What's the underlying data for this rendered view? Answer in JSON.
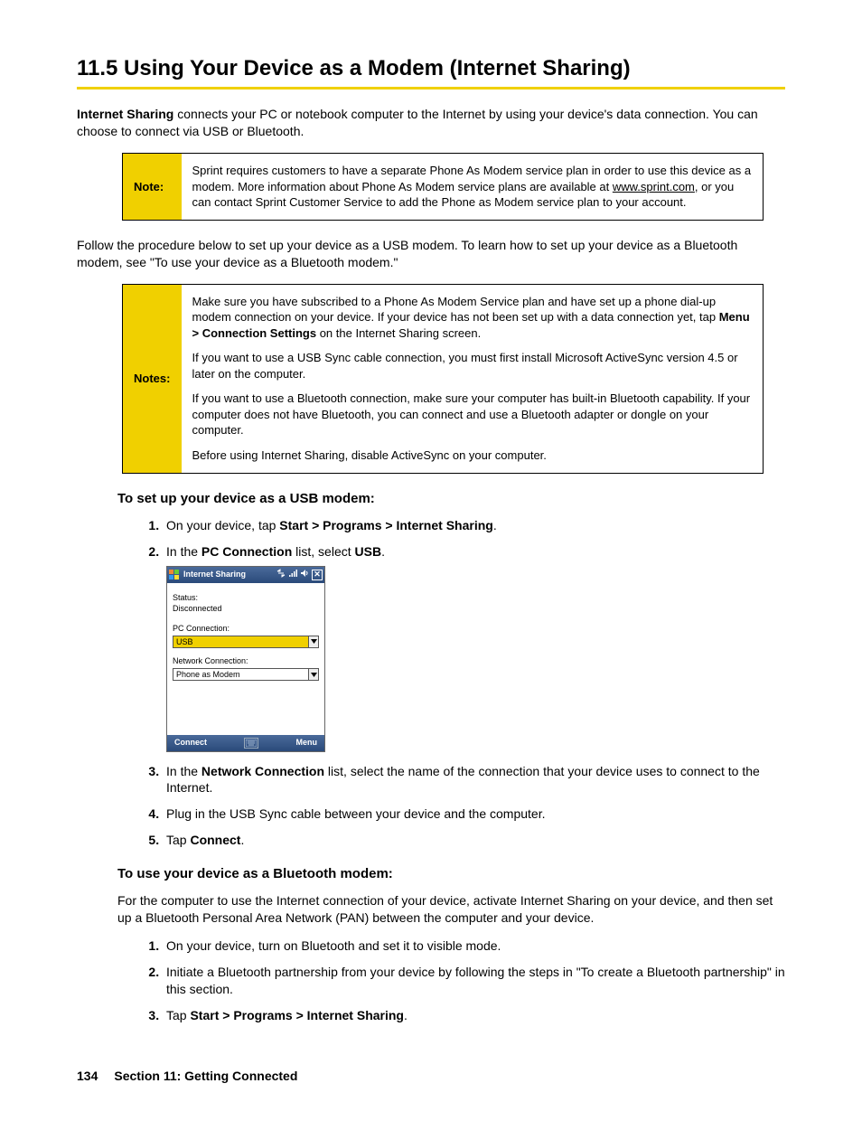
{
  "heading": "11.5  Using Your Device as a Modem (Internet Sharing)",
  "intro": {
    "lead_bold": "Internet Sharing",
    "lead_rest": " connects your PC or notebook computer to the Internet by using your device's data connection. You can choose to connect via USB or Bluetooth."
  },
  "note1": {
    "label": "Note:",
    "text_a": "Sprint requires customers to have a separate Phone As Modem service plan in order to use this device as a modem. More information about Phone As Modem service plans are available at ",
    "link": "www.sprint.com",
    "text_b": ", or you can contact Sprint Customer Service to add the Phone as Modem service plan to your account."
  },
  "follow": "Follow the procedure below to set up your device as a USB modem. To learn how to set up your device as a Bluetooth modem, see \"To use your device as a Bluetooth modem.\"",
  "note2": {
    "label": "Notes:",
    "p1a": "Make sure you have subscribed to a Phone As Modem Service plan and have set up a phone dial-up modem connection on your device. If your device has not been set up with a data connection yet, tap ",
    "p1b": "Menu > Connection Settings",
    "p1c": " on the Internet Sharing screen.",
    "p2": "If you want to use a USB Sync cable connection, you must first install Microsoft ActiveSync version 4.5 or later on the computer.",
    "p3": "If you want to use a Bluetooth connection, make sure your computer has built-in Bluetooth capability. If your computer does not have Bluetooth, you can connect and use a Bluetooth adapter or dongle on your computer.",
    "p4": "Before using Internet Sharing, disable ActiveSync on your computer."
  },
  "usb": {
    "heading": "To set up your device as a USB modem:",
    "s1a": "On your device, tap ",
    "s1b": "Start > Programs > Internet Sharing",
    "s1c": ".",
    "s2a": "In the ",
    "s2b": "PC Connection",
    "s2c": " list, select ",
    "s2d": "USB",
    "s2e": ".",
    "s3a": "In the ",
    "s3b": "Network Connection",
    "s3c": " list, select the name of the connection that your device uses to connect to the Internet.",
    "s4": "Plug in the USB Sync cable between your device and the computer.",
    "s5a": "Tap ",
    "s5b": "Connect",
    "s5c": "."
  },
  "bt": {
    "heading": "To use your device as a Bluetooth modem:",
    "intro": "For the computer to use the Internet connection of your device, activate Internet Sharing on your device, and then set up a Bluetooth Personal Area Network (PAN) between the computer and your device.",
    "s1": "On your device, turn on Bluetooth and set it to visible mode.",
    "s2": "Initiate a Bluetooth partnership from your device by following the steps in \"To create a Bluetooth partnership\" in this section.",
    "s3a": "Tap ",
    "s3b": "Start > Programs > Internet Sharing",
    "s3c": "."
  },
  "device": {
    "title": "Internet Sharing",
    "status_lbl": "Status:",
    "status_val": "Disconnected",
    "pc_lbl": "PC Connection:",
    "pc_val": "USB",
    "net_lbl": "Network Connection:",
    "net_val": "Phone as Modem",
    "soft_left": "Connect",
    "soft_right": "Menu"
  },
  "footer": {
    "page": "134",
    "section": "Section 11: Getting Connected"
  }
}
